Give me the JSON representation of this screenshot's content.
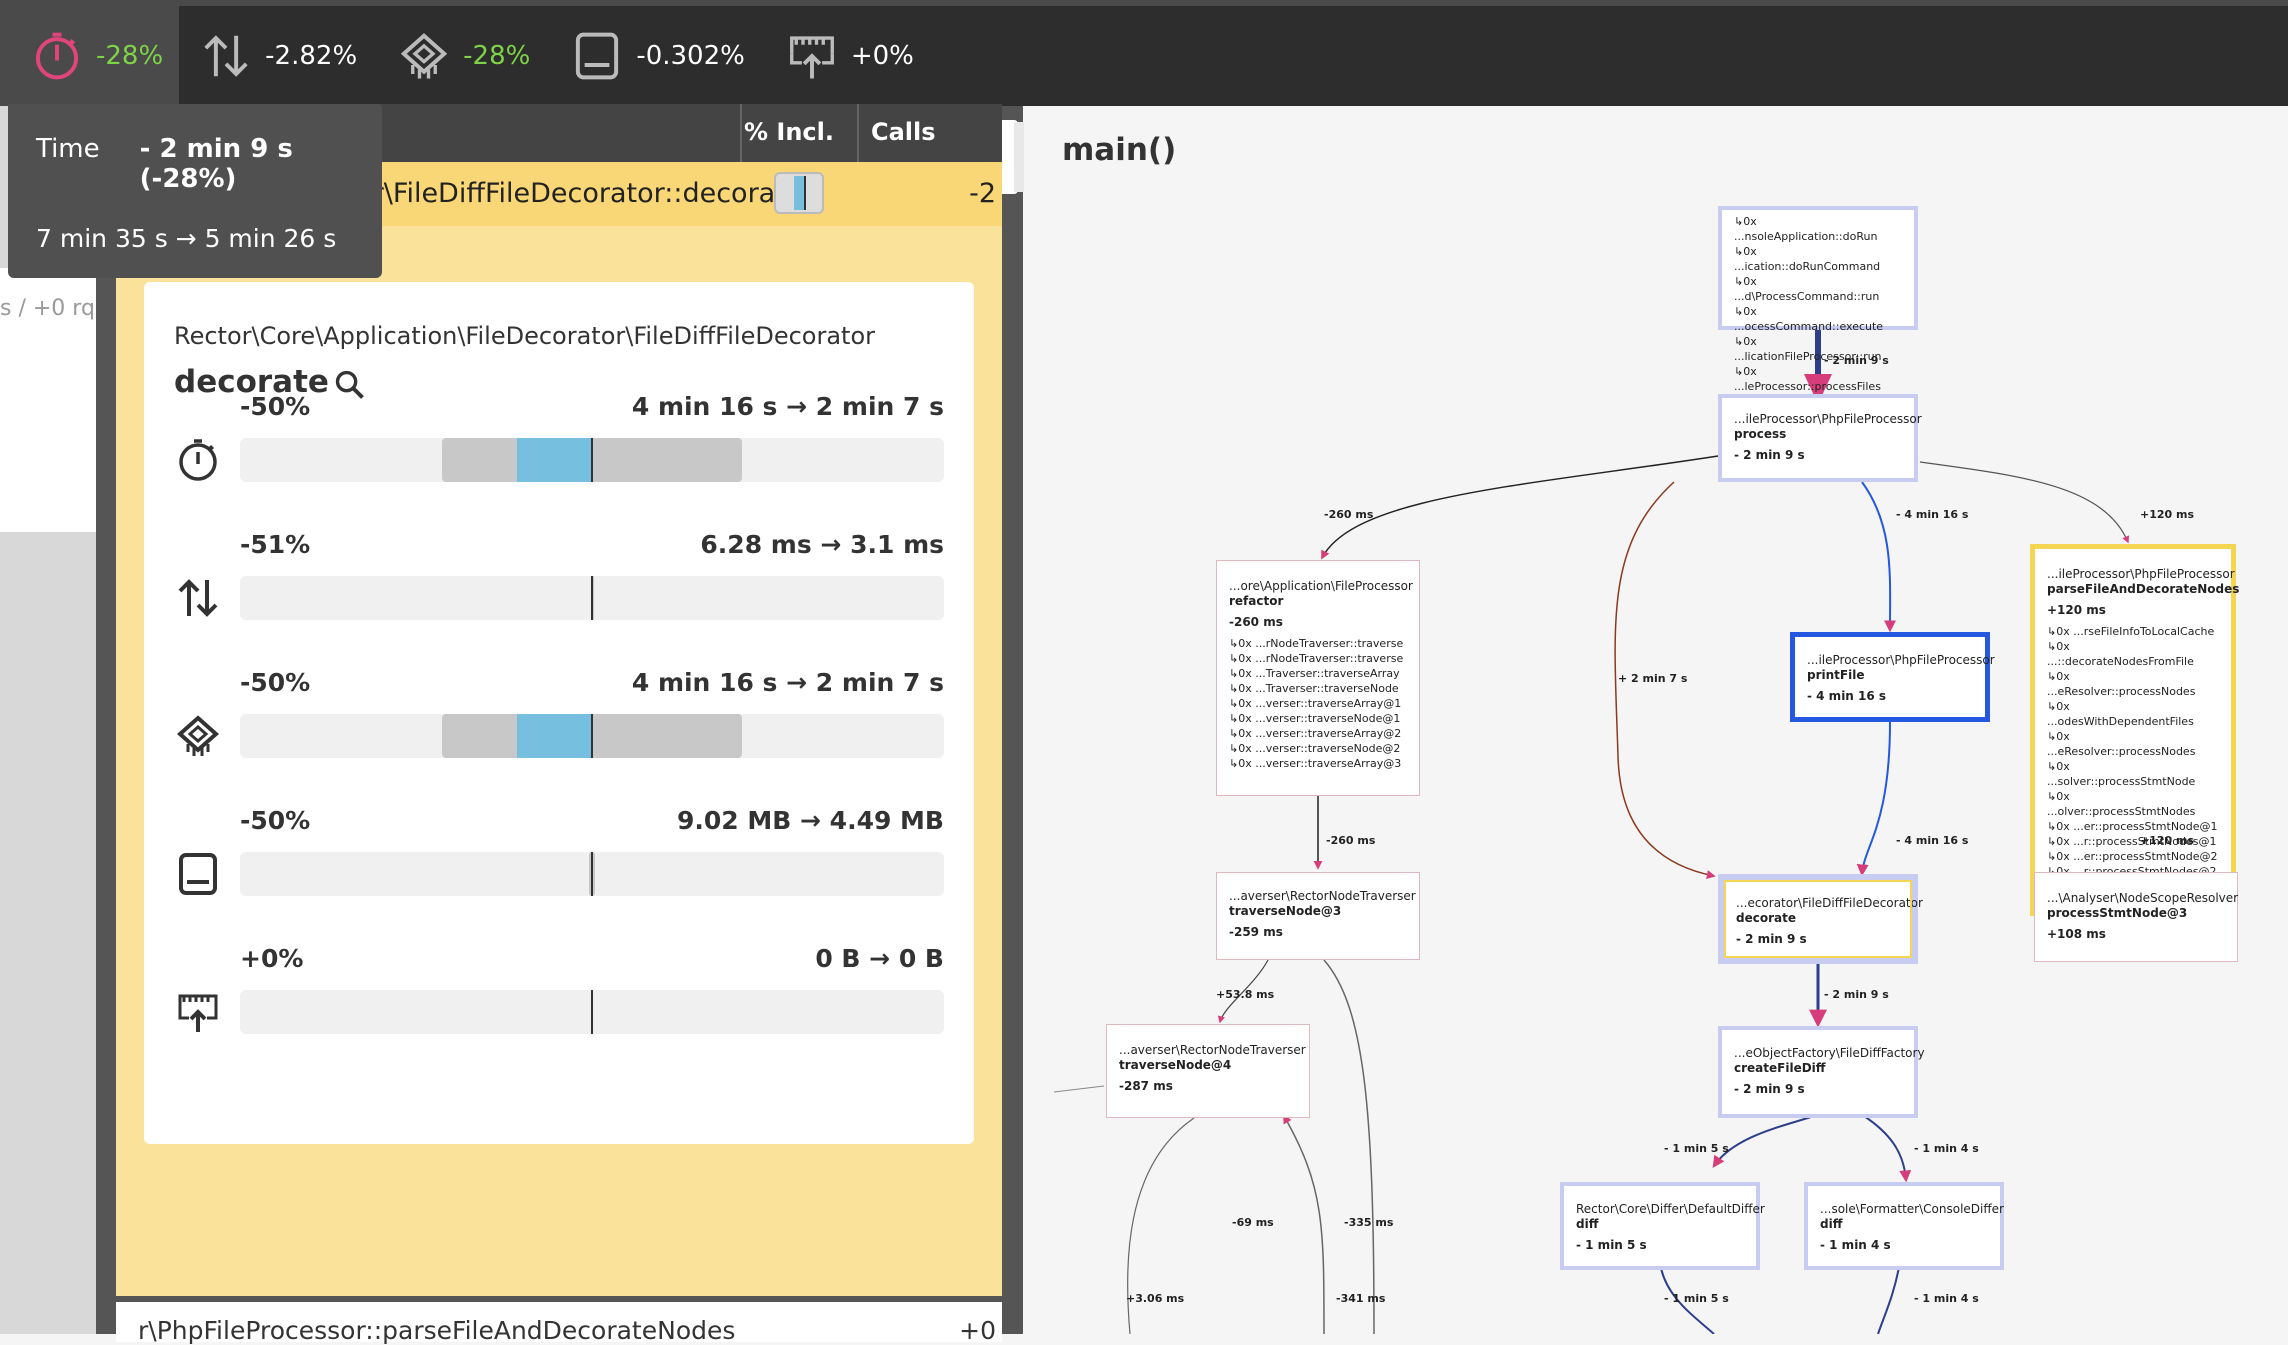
{
  "topbar": {
    "metrics": [
      {
        "icon": "stopwatch-icon",
        "value": "-28%",
        "color": "#7ed348"
      },
      {
        "icon": "io-arrows-icon",
        "value": "-2.82%",
        "color": "#ffffff"
      },
      {
        "icon": "cpu-icon",
        "value": "-28%",
        "color": "#7ed348"
      },
      {
        "icon": "memory-icon",
        "value": "-0.302%",
        "color": "#ffffff"
      },
      {
        "icon": "network-icon",
        "value": "+0%",
        "color": "#ffffff"
      }
    ]
  },
  "tooltip": {
    "label": "Time",
    "delta": "- 2 min 9 s (-28%)",
    "range": "7 min 35 s → 5 min 26 s"
  },
  "left_stub": {
    "text": "s / +0 rq"
  },
  "table": {
    "col_incl": "% Incl.",
    "col_calls": "Calls"
  },
  "selected": {
    "name": "...ion\\FileDecorator\\FileDiffFileDecorator::decorate",
    "delta": "-2"
  },
  "detail": {
    "namespace": "Rector\\Core\\Application\\FileDecorator\\FileDiffFileDecorator",
    "function": "decorate",
    "metrics": [
      {
        "icon": "stopwatch-icon",
        "pct": "-50%",
        "range": "4 min 16 s → 2 min 7 s",
        "before": 1.0,
        "after": 0.5
      },
      {
        "icon": "io-arrows-icon",
        "pct": "-51%",
        "range": "6.28 ms → 3.1 ms",
        "before": 0.01,
        "after": 0.005
      },
      {
        "icon": "cpu-icon",
        "pct": "-50%",
        "range": "4 min 16 s → 2 min 7 s",
        "before": 1.0,
        "after": 0.5
      },
      {
        "icon": "memory-icon",
        "pct": "-50%",
        "range": "9.02 MB → 4.49 MB",
        "before": 0.02,
        "after": 0.01
      },
      {
        "icon": "network-icon",
        "pct": "+0%",
        "range": "0 B → 0 B",
        "before": 0,
        "after": 0
      }
    ]
  },
  "next_row": {
    "name": "r\\PhpFileProcessor::parseFileAndDecorateNodes",
    "delta": "+0"
  },
  "graph": {
    "title": "main()",
    "nodes": [
      {
        "id": "top",
        "calls": [
          "↳0x ...nsoleApplication::doRun",
          "↳0x ...ication::doRunCommand",
          "↳0x ...d\\ProcessCommand::run",
          "↳0x ...ocessCommand::execute",
          "↳0x ...licationFileProcessor::run",
          "↳0x ...leProcessor::processFiles"
        ]
      },
      {
        "id": "process",
        "ns": "...ileProcessor\\PhpFileProcessor",
        "fn": "process",
        "val": "- 2 min 9 s"
      },
      {
        "id": "refactor",
        "ns": "...ore\\Application\\FileProcessor",
        "fn": "refactor",
        "val": "-260 ms",
        "calls": [
          "↳0x ...rNodeTraverser::traverse",
          "↳0x ...rNodeTraverser::traverse",
          "↳0x ...Traverser::traverseArray",
          "↳0x ...Traverser::traverseNode",
          "↳0x ...verser::traverseArray@1",
          "↳0x ...verser::traverseNode@1",
          "↳0x ...verser::traverseArray@2",
          "↳0x ...verser::traverseNode@2",
          "↳0x ...verser::traverseArray@3"
        ]
      },
      {
        "id": "printFile",
        "ns": "...ileProcessor\\PhpFileProcessor",
        "fn": "printFile",
        "val": "- 4 min 16 s"
      },
      {
        "id": "parseFile",
        "ns": "...ileProcessor\\PhpFileProcessor",
        "fn": "parseFileAndDecorateNodes",
        "val": "+120 ms",
        "calls": [
          "↳0x ...rseFileInfoToLocalCache",
          "↳0x ...::decorateNodesFromFile",
          "↳0x ...eResolver::processNodes",
          "↳0x ...odesWithDependentFiles",
          "↳0x ...eResolver::processNodes",
          "↳0x ...solver::processStmtNode",
          "↳0x ...olver::processStmtNodes",
          "↳0x ...er::processStmtNode@1",
          "↳0x ...r::processStmtNodes@1",
          "↳0x ...er::processStmtNode@2",
          "↳0x ...r::processStmtNodes@2"
        ]
      },
      {
        "id": "traverse3",
        "ns": "...averser\\RectorNodeTraverser",
        "fn": "traverseNode@3",
        "val": "-259 ms"
      },
      {
        "id": "decorate",
        "ns": "...ecorator\\FileDiffFileDecorator",
        "fn": "decorate",
        "val": "- 2 min 9 s"
      },
      {
        "id": "scope",
        "ns": "...\\Analyser\\NodeScopeResolver",
        "fn": "processStmtNode@3",
        "val": "+108 ms"
      },
      {
        "id": "traverse4",
        "ns": "...averser\\RectorNodeTraverser",
        "fn": "traverseNode@4",
        "val": "-287 ms"
      },
      {
        "id": "createFileDiff",
        "ns": "...eObjectFactory\\FileDiffFactory",
        "fn": "createFileDiff",
        "val": "- 2 min 9 s"
      },
      {
        "id": "diff1",
        "ns": "Rector\\Core\\Differ\\DefaultDiffer",
        "fn": "diff",
        "val": "- 1 min 5 s"
      },
      {
        "id": "diff2",
        "ns": "...sole\\Formatter\\ConsoleDiffer",
        "fn": "diff",
        "val": "- 1 min 4 s"
      }
    ],
    "edges": [
      {
        "label": "- 2 min 9 s"
      },
      {
        "label": "-260 ms"
      },
      {
        "label": "- 4 min 16 s"
      },
      {
        "label": "+120 ms"
      },
      {
        "label": "+ 2 min 7 s"
      },
      {
        "label": "-260 ms"
      },
      {
        "label": "- 4 min 16 s"
      },
      {
        "label": "+120 ms"
      },
      {
        "label": "+53.8 ms"
      },
      {
        "label": "- 2 min 9 s"
      },
      {
        "label": "- 1 min 5 s"
      },
      {
        "label": "- 1 min 4 s"
      },
      {
        "label": "-69 ms"
      },
      {
        "label": "-335 ms"
      },
      {
        "label": "+3.06 ms"
      },
      {
        "label": "-341 ms"
      },
      {
        "label": "- 1 min 5 s"
      },
      {
        "label": "- 1 min 4 s"
      }
    ]
  },
  "colors": {
    "accent_green": "#7ed348",
    "selected_yellow": "#f9d776",
    "bar_blue": "#76bfde",
    "node_blue": "#2458e0",
    "edge_pink": "#d63d7a"
  }
}
